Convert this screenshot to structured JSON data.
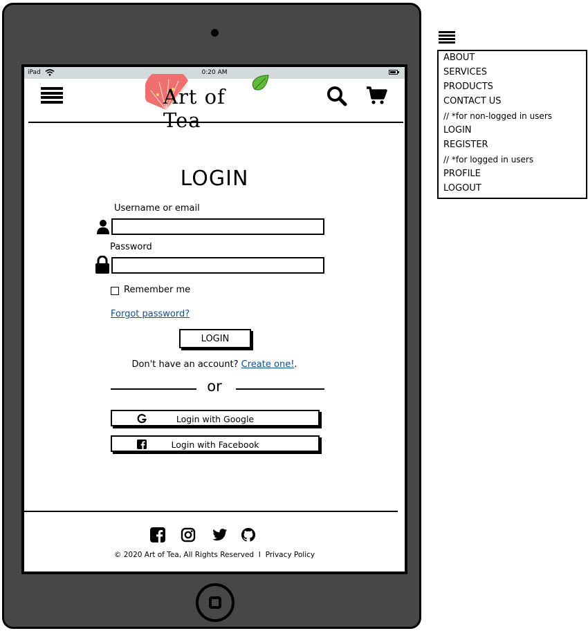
{
  "status_bar": {
    "carrier": "iPad",
    "time": "0:20 AM"
  },
  "header": {
    "logo_text": "Art of Tea"
  },
  "login": {
    "title": "LOGIN",
    "username_label": "Username or email",
    "username_value": "",
    "password_label": "Password",
    "password_value": "",
    "remember_label": "Remember me",
    "remember_checked": false,
    "forgot_link": "Forgot password?",
    "submit_label": "LOGIN",
    "signup_prompt": "Don't have an account?",
    "signup_link": "Create one!",
    "signup_suffix": ".",
    "or_text": "or",
    "google_label": "Login with Google",
    "facebook_label": "Login with Facebook"
  },
  "footer": {
    "icons": [
      "facebook-icon",
      "instagram-icon",
      "twitter-icon",
      "github-icon"
    ],
    "copyright": "© 2020 Art of Tea, All Rights Reserved",
    "separator": "I",
    "privacy_link": "Privacy Policy"
  },
  "nav_menu": {
    "items": [
      "ABOUT",
      "SERVICES",
      "PRODUCTS",
      "CONTACT US",
      "// *for non-logged in users",
      "LOGIN",
      "REGISTER",
      "// *for logged in users",
      "PROFILE",
      "LOGOUT"
    ]
  },
  "colors": {
    "link": "#0e4f8e",
    "status_bar": "#d3dadc",
    "device_frame": "#474747"
  }
}
